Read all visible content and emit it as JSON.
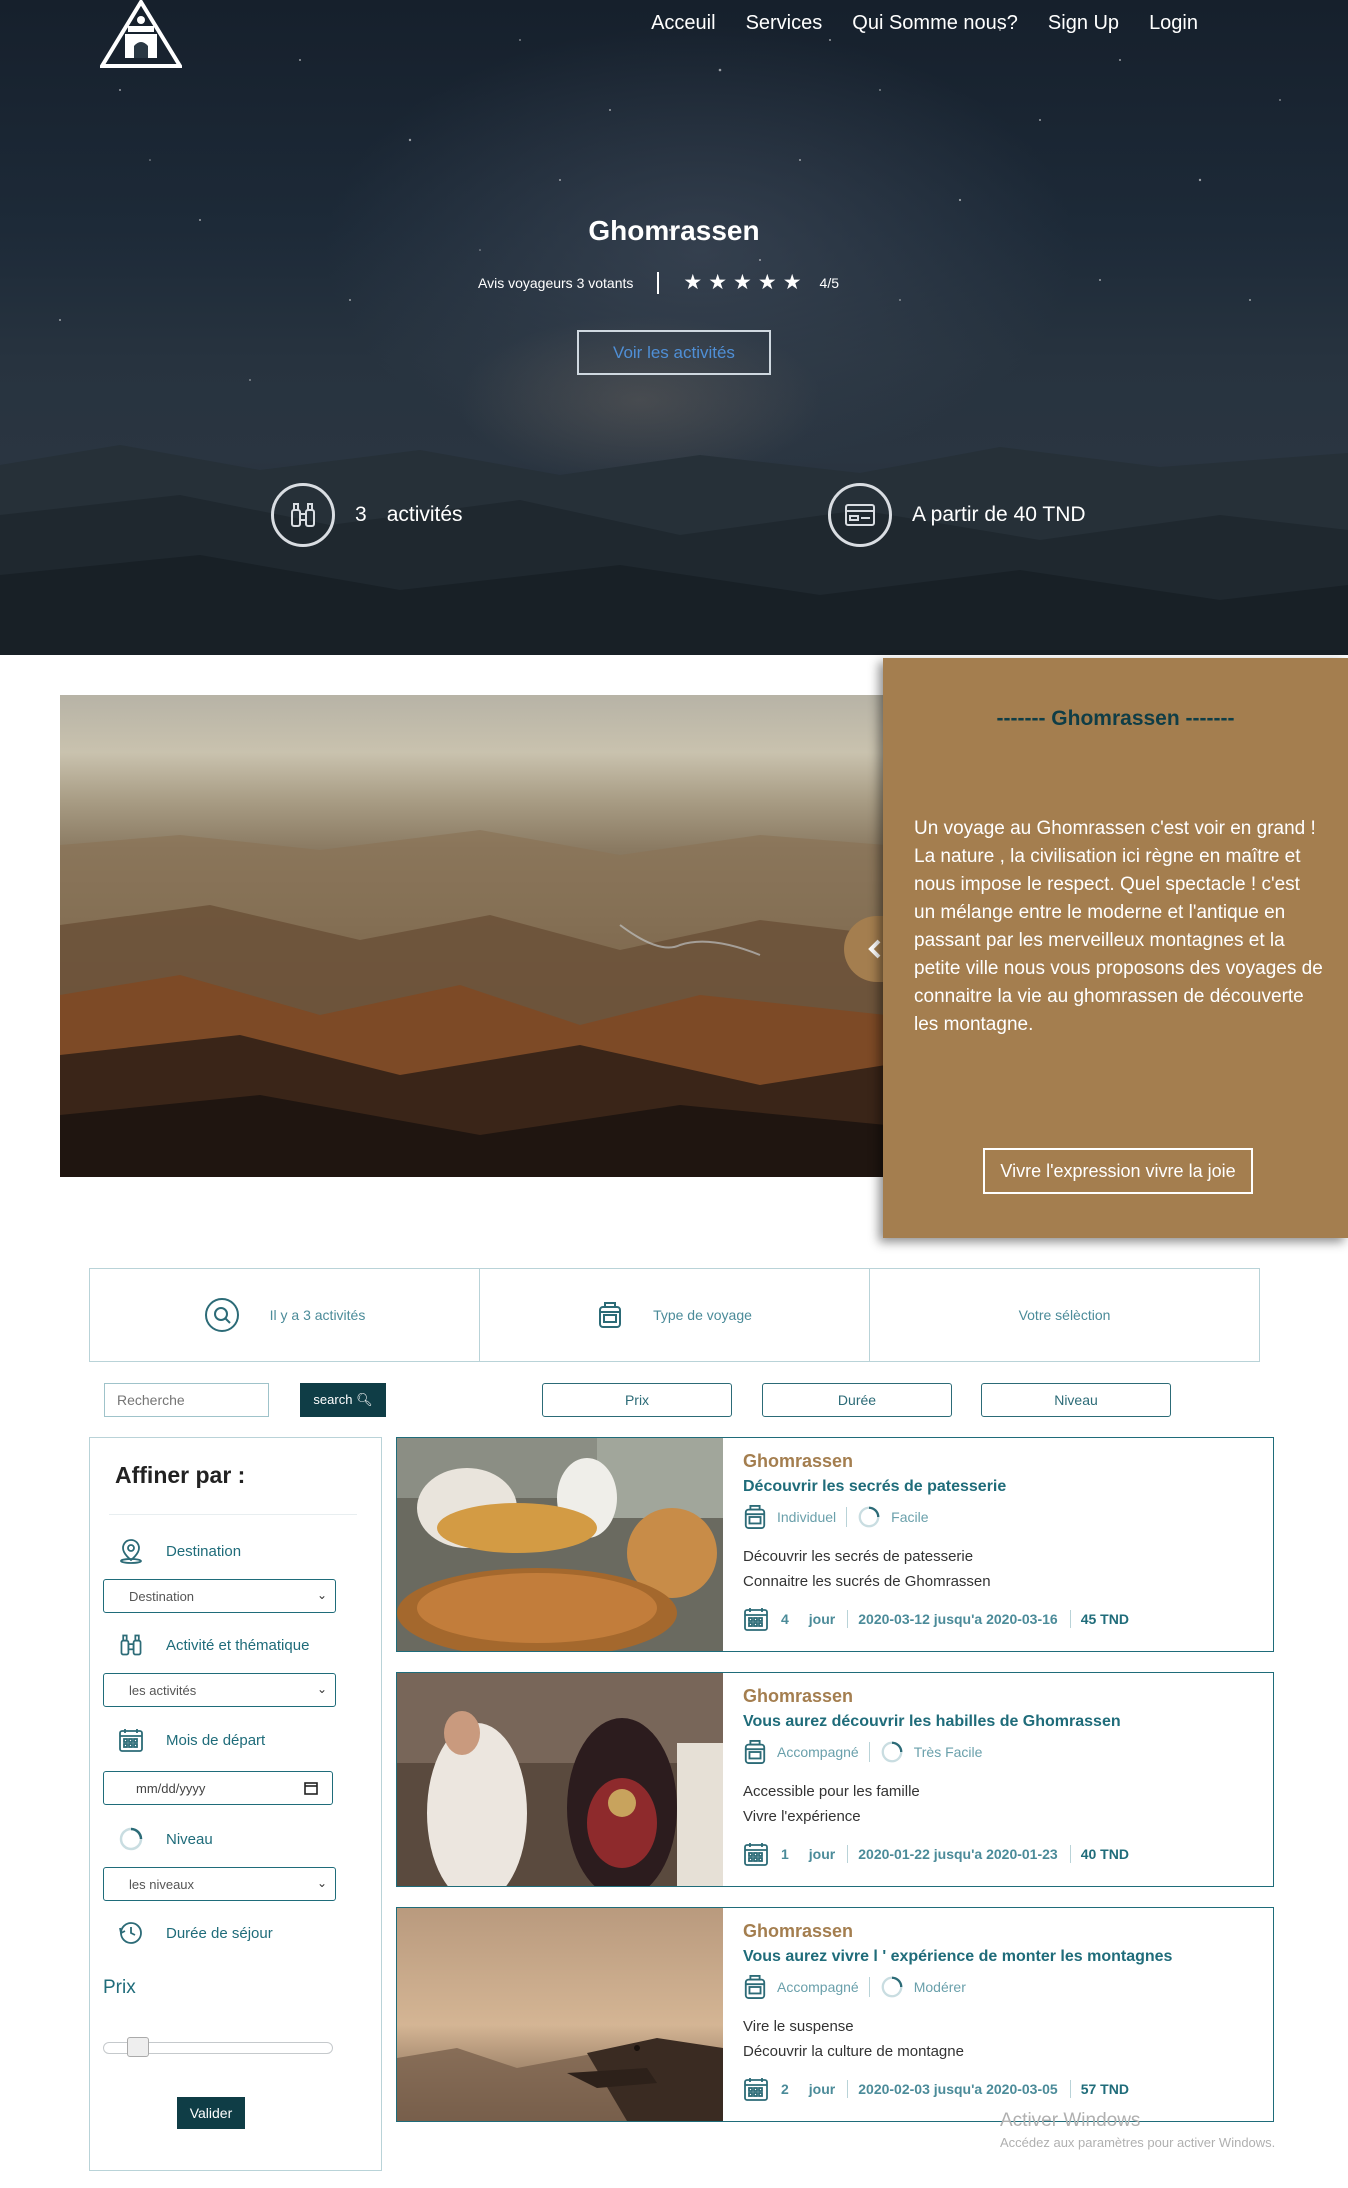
{
  "nav": {
    "items": [
      "Acceuil",
      "Services",
      "Qui Somme nous?",
      "Sign Up",
      "Login"
    ]
  },
  "hero": {
    "title": "Ghomrassen",
    "rating_text": "Avis voyageurs 3 votants",
    "stars": 5,
    "score": "4/5",
    "button": "Voir les activités",
    "activities_count": "3",
    "activities_label": "activités",
    "price_text": "A partir de 40 TND"
  },
  "feature": {
    "panel_title": "------- Ghomrassen -------",
    "description": "Un voyage au Ghomrassen c'est voir en grand ! La nature , la civilisation ici règne en maître et nous impose le respect. Quel spectacle ! c'est un mélange entre le moderne et l'antique en passant par les merveilleux montagnes et la petite ville nous vous proposons des voyages de connaitre la vie au ghomrassen de découverte les montagne.",
    "button": "Vivre l'expression vivre la joie"
  },
  "infobar": {
    "count_text": "Il y a 3 activités",
    "type_text": "Type de voyage",
    "selection_text": "Votre sélèction"
  },
  "toolbar": {
    "search_placeholder": "Recherche",
    "search_button": "search",
    "sort_prix": "Prix",
    "sort_duree": "Durée",
    "sort_niveau": "Niveau"
  },
  "sidebar": {
    "title": "Affiner par :",
    "destination_label": "Destination",
    "destination_select": "Destination",
    "activite_label": "Activité et thématique",
    "activite_select": "les activités",
    "mois_label": "Mois de départ",
    "mois_placeholder": "mm/dd/yyyy",
    "niveau_label": "Niveau",
    "niveau_select": "les niveaux",
    "duree_label": "Durée de séjour",
    "prix_label": "Prix",
    "price_slider_fraction": 0.15,
    "valider": "Valider"
  },
  "cards": [
    {
      "city": "Ghomrassen",
      "name": "Découvrir les secrés de patesserie",
      "type": "Individuel",
      "level": "Facile",
      "line1": "Découvrir les secrés de patesserie",
      "line2": "Connaitre les sucrés de Ghomrassen",
      "days": "4",
      "unit": "jour",
      "dates": "2020-03-12 jusqu'a 2020-03-16",
      "price": "45 TND"
    },
    {
      "city": "Ghomrassen",
      "name": "Vous aurez découvrir les habilles de Ghomrassen",
      "type": "Accompagné",
      "level": "Très Facile",
      "line1": "Accessible pour les famille",
      "line2": "Vivre l'expérience",
      "days": "1",
      "unit": "jour",
      "dates": "2020-01-22 jusqu'a 2020-01-23",
      "price": "40 TND"
    },
    {
      "city": "Ghomrassen",
      "name": "Vous aurez vivre l ' expérience de monter les montagnes",
      "type": "Accompagné",
      "level": "Modérer",
      "line1": "Vire le suspense",
      "line2": "Découvrir la culture de montagne",
      "days": "2",
      "unit": "jour",
      "dates": "2020-02-03 jusqu'a 2020-03-05",
      "price": "57 TND"
    }
  ],
  "watermark": {
    "line1": "Activer Windows",
    "line2": "Accédez aux paramètres pour activer Windows."
  },
  "colors": {
    "accent_brown": "#a47e4f",
    "dark_teal": "#0f3d46",
    "teal": "#1f6c7a",
    "light_teal": "#4b8b99"
  }
}
